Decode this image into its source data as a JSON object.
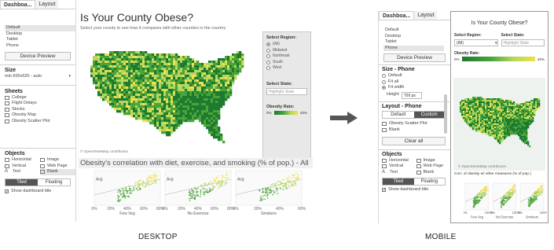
{
  "desktop": {
    "side": {
      "tabs": [
        "Dashboa...",
        "Layout"
      ],
      "devices": [
        "Default",
        "Desktop",
        "Tablet",
        "Phone"
      ],
      "selected_device": "Default",
      "device_preview_label": "Device Preview",
      "size_title": "Size",
      "size_value": "min 600x520 - auto",
      "sheets_title": "Sheets",
      "sheets": [
        "College",
        "Flight Delays",
        "Stocks",
        "Obesity Map",
        "Obesity Scatter Plot"
      ],
      "objects_title": "Objects",
      "objects": [
        {
          "label": "Horizontal",
          "icon": "horizontal-container-icon"
        },
        {
          "label": "Image",
          "icon": "image-icon"
        },
        {
          "label": "Vertical",
          "icon": "vertical-container-icon"
        },
        {
          "label": "Web Page",
          "icon": "web-page-icon"
        },
        {
          "label": "Text",
          "icon": "text-icon"
        },
        {
          "label": "Blank",
          "icon": "blank-icon"
        }
      ],
      "tiled_label": "Tiled",
      "floating_label": "Floating",
      "show_title_label": "Show dashboard title"
    },
    "dashboard": {
      "title": "Is Your County Obese?",
      "subtitle": "Select your county to see how it compares with other counties in the country",
      "region_label": "Select Region:",
      "regions": [
        "(All)",
        "Midwest",
        "Northeast",
        "South",
        "West"
      ],
      "state_label": "Select State:",
      "state_placeholder": "Highlight State",
      "rate_label": "Obesity Rate:",
      "rate_min": "0%",
      "rate_max": "40%",
      "osm": "© OpenStreetMap contributors",
      "banner": "Obesity's correlation with diet, exercise, and smoking (% of pop.) - All",
      "avg_label": "Avg",
      "scatter_ticks": [
        [
          "0%",
          "20%",
          "40%",
          "60%",
          "80%"
        ],
        [
          "0%",
          "20%",
          "40%",
          "60%",
          "80%"
        ],
        [
          "0%",
          "20%",
          "40%",
          "60%"
        ]
      ],
      "scatter_xlabels": [
        "Few Veg",
        "No Exercise",
        "Smokers"
      ]
    },
    "caption": "DESKTOP"
  },
  "mobile": {
    "side": {
      "tabs": [
        "Dashboa...",
        "Layout"
      ],
      "devices": [
        "Default",
        "Desktop",
        "Tablet",
        "Phone"
      ],
      "selected_device": "Phone",
      "device_preview_label": "Device Preview",
      "size_title": "Size - Phone",
      "size_options": [
        "Default",
        "Fit all",
        "Fit width"
      ],
      "size_selected": "Fit width",
      "height_label": "Height",
      "height_value": "700 px",
      "layout_title": "Layout - Phone",
      "layout_default": "Default",
      "layout_custom": "Custom",
      "layout_items": [
        "Obesity Scatter Plot",
        "Blank"
      ],
      "clear_all": "Clear all",
      "objects_title": "Objects",
      "objects": [
        {
          "label": "Horizontal",
          "icon": "horizontal-container-icon"
        },
        {
          "label": "Image",
          "icon": "image-icon"
        },
        {
          "label": "Vertical",
          "icon": "vertical-container-icon"
        },
        {
          "label": "Web Page",
          "icon": "web-page-icon"
        },
        {
          "label": "Text",
          "icon": "text-icon"
        },
        {
          "label": "Blank",
          "icon": "blank-icon"
        }
      ],
      "tiled_label": "Tiled",
      "floating_label": "Floating",
      "show_title_label": "Show dashboard title"
    },
    "dashboard": {
      "title": "Is Your County Obese?",
      "region_label": "Select Region:",
      "region_value": "(All)",
      "state_label": "Select State:",
      "state_placeholder": "Highlight State",
      "rate_label": "Obesity Rate:",
      "rate_min": "0%",
      "rate_max": "40%",
      "osm": "© OpenStreetMap contributors",
      "corr_label": "Corr. of obesity w/ other measures (% of pop.)",
      "scatter_ticks": [
        [
          "0%",
          "100%"
        ],
        [
          "0%",
          "100%"
        ],
        [
          "0%",
          "100%"
        ]
      ],
      "scatter_xlabels": [
        "Few Veg",
        "No Exercise",
        "Smokers"
      ]
    },
    "caption": "MOBILE"
  },
  "colors": {
    "map_dark": "#1d7a2f",
    "map_mid": "#4aa43a",
    "map_light": "#b7d65d",
    "map_yellow": "#f0e04a",
    "panel_gray": "#e8e8e8"
  }
}
